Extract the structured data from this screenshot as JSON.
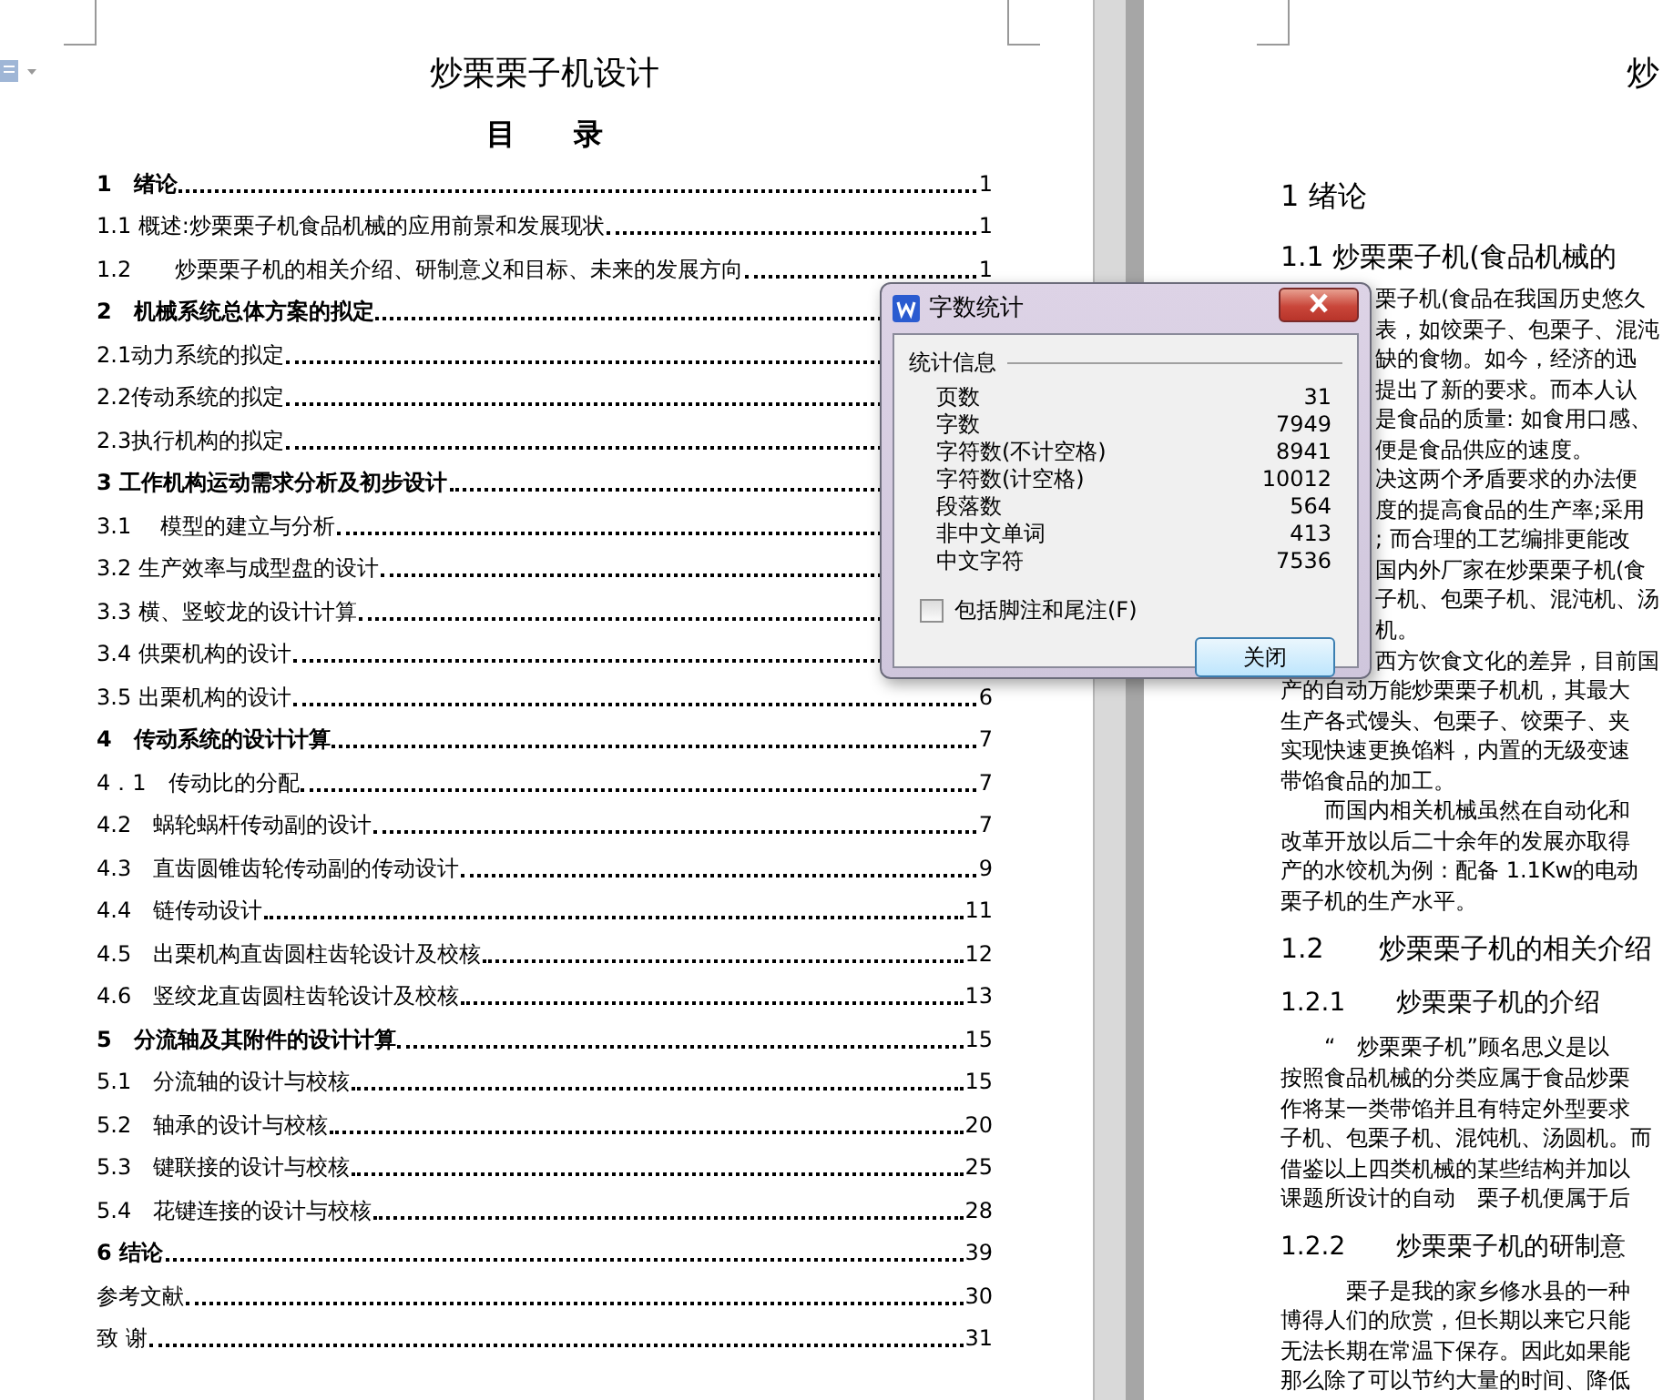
{
  "left_page": {
    "title": "炒栗栗子机设计",
    "toc_heading": "目　　录",
    "toc": [
      {
        "kind": "chapter",
        "text": "1　绪论",
        "page": "1"
      },
      {
        "kind": "section",
        "text": "1.1  概述:炒栗栗子机食品机械的应用前景和发展现状",
        "page": "1"
      },
      {
        "kind": "section",
        "text": "1.2　　炒栗栗子机的相关介绍、研制意义和目标、未来的发展方向",
        "page": "1"
      },
      {
        "kind": "chapter",
        "text": "2　机械系统总体方案的拟定"
      },
      {
        "kind": "section",
        "text": "2.1动力系统的拟定"
      },
      {
        "kind": "section",
        "text": "2.2传动系统的拟定"
      },
      {
        "kind": "section",
        "text": "2.3执行机构的拟定"
      },
      {
        "kind": "chapter",
        "text": "3 工作机构运动需求分析及初步设计"
      },
      {
        "kind": "section",
        "text": "3.1　 模型的建立与分析"
      },
      {
        "kind": "section",
        "text": "3.2 生产效率与成型盘的设计"
      },
      {
        "kind": "section",
        "text": "3.3 横、竖蛟龙的设计计算"
      },
      {
        "kind": "section",
        "text": "3.4 供栗机构的设计"
      },
      {
        "kind": "section",
        "text": "3.5 出栗机构的设计",
        "page": "6"
      },
      {
        "kind": "chapter",
        "text": "4　传动系统的设计计算",
        "page": "7"
      },
      {
        "kind": "section",
        "text": "4．1　传动比的分配",
        "page": "7"
      },
      {
        "kind": "section",
        "text": "4.2　蜗轮蜗杆传动副的设计",
        "page": "7"
      },
      {
        "kind": "section",
        "text": "4.3　直齿圆锥齿轮传动副的传动设计",
        "page": "9"
      },
      {
        "kind": "section",
        "text": "4.4　链传动设计",
        "page": "11"
      },
      {
        "kind": "section",
        "text": "4.5　出栗机构直齿圆柱齿轮设计及校核",
        "page": "12"
      },
      {
        "kind": "section",
        "text": "4.6　竖绞龙直齿圆柱齿轮设计及校核",
        "page": "13"
      },
      {
        "kind": "chapter",
        "text": "5　分流轴及其附件的设计计算",
        "page": "15"
      },
      {
        "kind": "section",
        "text": "5.1　分流轴的设计与校核",
        "page": "15"
      },
      {
        "kind": "section",
        "text": "5.2　轴承的设计与校核",
        "page": "20"
      },
      {
        "kind": "section",
        "text": "5.3　键联接的设计与校核",
        "page": "25"
      },
      {
        "kind": "section",
        "text": "5.4　花键连接的设计与校核",
        "page": "28"
      },
      {
        "kind": "chapter",
        "text": "6 结论",
        "page": "39"
      },
      {
        "kind": "section",
        "text": "参考文献",
        "page": "30"
      },
      {
        "kind": "section",
        "text": "致 谢",
        "page": "31"
      }
    ]
  },
  "right_page": {
    "title": "炒",
    "blocks": [
      {
        "kind": "h1",
        "text": "1 绪论"
      },
      {
        "kind": "h2",
        "text": "1.1 炒栗栗子机(食品机械的"
      },
      {
        "kind": "partial",
        "text": "栗子机(食品在我国历史悠久"
      },
      {
        "kind": "partial",
        "text": "表，如饺栗子、包栗子、混沌"
      },
      {
        "kind": "partial",
        "text": "缺的食物。如今，经济的迅"
      },
      {
        "kind": "partial",
        "text": "提出了新的要求。而本人认"
      },
      {
        "kind": "partial",
        "text": "是食品的质量: 如食用口感、"
      },
      {
        "kind": "partial",
        "text": "便是食品供应的速度。"
      },
      {
        "kind": "partial",
        "text": "决这两个矛盾要求的办法便"
      },
      {
        "kind": "partial",
        "text": "度的提高食品的生产率;采用"
      },
      {
        "kind": "partial",
        "text": "; 而合理的工艺编排更能改"
      },
      {
        "kind": "partial",
        "text": "国内外厂家在炒栗栗子机(食"
      },
      {
        "kind": "partial",
        "text": "子机、包栗子机、混沌机、汤"
      },
      {
        "kind": "partial",
        "text": "机。"
      },
      {
        "kind": "partial",
        "text": "西方饮食文化的差异，目前国"
      },
      {
        "kind": "body",
        "text": "产的自动万能炒栗栗子机机，其最大"
      },
      {
        "kind": "body",
        "text": "生产各式馒头、包栗子、饺栗子、夹"
      },
      {
        "kind": "body",
        "text": "实现快速更换馅料，内置的无级变速"
      },
      {
        "kind": "body",
        "text": "带馅食品的加工。"
      },
      {
        "kind": "body",
        "text": "　　而国内相关机械虽然在自动化和"
      },
      {
        "kind": "body",
        "text": "改革开放以后二十余年的发展亦取得"
      },
      {
        "kind": "body",
        "text": "产的水饺机为例：配备 1.1Kw的电动"
      },
      {
        "kind": "body",
        "text": "栗子机的生产水平。"
      },
      {
        "kind": "h2",
        "text": "1.2　　炒栗栗子机的相关介绍"
      },
      {
        "kind": "h3",
        "text": "1.2.1　　炒栗栗子机的介绍"
      },
      {
        "kind": "body",
        "text": "　　“　炒栗栗子机”顾名思义是以"
      },
      {
        "kind": "body",
        "text": "按照食品机械的分类应属于食品炒栗"
      },
      {
        "kind": "body",
        "text": "作将某一类带馅并且有特定外型要求"
      },
      {
        "kind": "body",
        "text": "子机、包栗子机、混饨机、汤圆机。而"
      },
      {
        "kind": "body",
        "text": "借鉴以上四类机械的某些结构并加以"
      },
      {
        "kind": "body",
        "text": "课题所设计的自动　栗子机便属于后"
      },
      {
        "kind": "h3",
        "text": "1.2.2　　炒栗栗子机的研制意"
      },
      {
        "kind": "body",
        "text": "　　　栗子是我的家乡修水县的一种"
      },
      {
        "kind": "body",
        "text": "博得人们的欣赏，但长期以来它只能"
      },
      {
        "kind": "body",
        "text": "无法长期在常温下保存。因此如果能"
      },
      {
        "kind": "body",
        "text": "那么除了可以节约大量的时间、降低"
      }
    ]
  },
  "dialog": {
    "title": "字数统计",
    "group": "统计信息",
    "stats": [
      {
        "label": "页数",
        "value": "31"
      },
      {
        "label": "字数",
        "value": "7949"
      },
      {
        "label": "字符数(不计空格)",
        "value": "8941"
      },
      {
        "label": "字符数(计空格)",
        "value": "10012"
      },
      {
        "label": "段落数",
        "value": "564"
      },
      {
        "label": "非中文单词",
        "value": "413"
      },
      {
        "label": "中文字符",
        "value": "7536"
      }
    ],
    "checkbox": {
      "label": "包括脚注和尾注(F)",
      "checked": false
    },
    "button": "关闭"
  }
}
